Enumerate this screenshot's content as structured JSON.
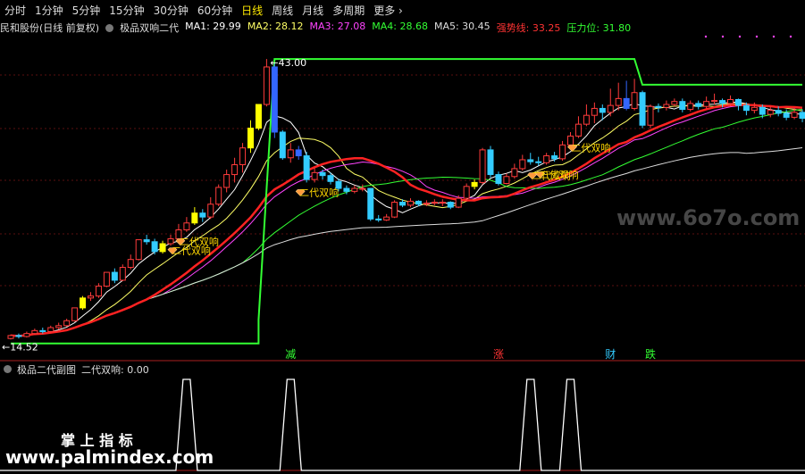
{
  "toolbar": {
    "items": [
      "分时",
      "1分钟",
      "5分钟",
      "15分钟",
      "30分钟",
      "60分钟",
      "日线",
      "周线",
      "月线",
      "多周期",
      "更多"
    ],
    "active_index": 6
  },
  "header": {
    "stock_name": "民和股份(日线 前复权)",
    "indicator_name": "极品双响二代",
    "ma_labels": [
      {
        "text": "MA1: 29.99",
        "color": "#ffffff"
      },
      {
        "text": "MA2: 28.12",
        "color": "#ffff66"
      },
      {
        "text": "MA3: 27.08",
        "color": "#ff44ff"
      },
      {
        "text": "MA4: 28.68",
        "color": "#33ff33"
      },
      {
        "text": "MA5: 30.45",
        "color": "#dddddd"
      },
      {
        "text": "强势线: 33.25",
        "color": "#ff3333"
      },
      {
        "text": "压力位: 31.80",
        "color": "#33ff33"
      }
    ]
  },
  "sub_panel": {
    "title": "极品二代副图",
    "value_label": "二代双响: 0.00"
  },
  "watermarks": {
    "top_right": "www.6o7o.com",
    "bottom_left_cn": "掌 上 指 标",
    "bottom_left_url": "www.palmindex.com"
  },
  "chart_data": {
    "type": "candlestick",
    "price_range": [
      13.0,
      45.0
    ],
    "high_label": "43.00",
    "low_label": "14.52",
    "candles": [
      [
        14.7,
        15.0,
        14.6,
        15.1
      ],
      [
        15.0,
        14.9,
        14.7,
        15.2
      ],
      [
        14.9,
        15.2,
        14.8,
        15.4
      ],
      [
        15.2,
        15.5,
        15.1,
        15.7
      ],
      [
        15.5,
        15.4,
        15.2,
        15.8
      ],
      [
        15.4,
        15.8,
        15.3,
        16.0
      ],
      [
        15.8,
        16.0,
        15.6,
        16.3
      ],
      [
        16.0,
        16.5,
        15.9,
        16.7
      ],
      [
        16.5,
        17.8,
        16.4,
        17.8
      ],
      [
        17.8,
        18.8,
        17.6,
        19.0
      ],
      [
        18.8,
        19.0,
        18.5,
        19.4
      ],
      [
        19.0,
        20.0,
        18.8,
        20.3
      ],
      [
        20.0,
        21.4,
        19.9,
        21.4
      ],
      [
        21.4,
        20.6,
        20.3,
        21.8
      ],
      [
        20.6,
        21.9,
        20.5,
        22.2
      ],
      [
        21.9,
        22.7,
        21.7,
        23.2
      ],
      [
        22.7,
        24.7,
        22.6,
        24.7
      ],
      [
        24.7,
        24.5,
        24.2,
        25.2
      ],
      [
        24.5,
        23.5,
        23.2,
        24.8
      ],
      [
        23.5,
        24.3,
        23.3,
        24.6
      ],
      [
        24.3,
        24.8,
        24.1,
        25.2
      ],
      [
        24.8,
        25.7,
        24.6,
        26.3
      ],
      [
        25.7,
        26.4,
        25.5,
        27.0
      ],
      [
        26.4,
        27.4,
        26.2,
        28.0
      ],
      [
        27.4,
        27.0,
        26.5,
        27.8
      ],
      [
        27.0,
        28.3,
        26.8,
        29.0
      ],
      [
        28.3,
        30.0,
        28.1,
        30.3
      ],
      [
        30.0,
        31.3,
        29.5,
        31.8
      ],
      [
        31.3,
        32.3,
        30.5,
        33.0
      ],
      [
        32.3,
        34.0,
        31.5,
        34.5
      ],
      [
        34.0,
        36.0,
        33.5,
        36.8
      ],
      [
        36.0,
        38.4,
        35.8,
        38.4
      ],
      [
        38.4,
        42.2,
        38.2,
        43.0
      ],
      [
        42.2,
        35.6,
        35.0,
        42.5
      ],
      [
        35.6,
        33.0,
        32.8,
        35.8
      ],
      [
        33.0,
        33.8,
        32.5,
        34.5
      ],
      [
        33.8,
        33.2,
        32.8,
        34.2
      ],
      [
        33.2,
        30.8,
        30.5,
        33.6
      ],
      [
        30.8,
        31.5,
        30.5,
        32.0
      ],
      [
        31.5,
        31.2,
        30.8,
        31.8
      ],
      [
        31.2,
        30.6,
        30.3,
        31.5
      ],
      [
        30.6,
        29.9,
        29.6,
        30.9
      ],
      [
        29.9,
        29.6,
        29.3,
        30.2
      ],
      [
        29.6,
        29.9,
        29.4,
        30.2
      ],
      [
        29.9,
        29.9,
        29.6,
        30.3
      ],
      [
        29.9,
        26.8,
        26.6,
        29.9
      ],
      [
        26.8,
        26.7,
        26.5,
        27.2
      ],
      [
        26.7,
        27.0,
        26.6,
        27.3
      ],
      [
        27.0,
        28.5,
        26.9,
        28.7
      ],
      [
        28.5,
        28.2,
        28.0,
        28.8
      ],
      [
        28.2,
        28.6,
        28.0,
        28.9
      ],
      [
        28.6,
        28.3,
        28.1,
        28.7
      ],
      [
        28.3,
        28.4,
        28.1,
        28.7
      ],
      [
        28.4,
        28.5,
        28.2,
        28.8
      ],
      [
        28.5,
        28.5,
        28.1,
        28.8
      ],
      [
        28.5,
        28.0,
        27.8,
        28.6
      ],
      [
        28.0,
        28.9,
        27.9,
        29.2
      ],
      [
        28.9,
        30.1,
        28.7,
        30.4
      ],
      [
        30.1,
        30.5,
        29.8,
        30.8
      ],
      [
        30.5,
        33.8,
        30.3,
        34.0
      ],
      [
        33.8,
        31.3,
        31.0,
        34.2
      ],
      [
        31.3,
        30.4,
        30.2,
        31.6
      ],
      [
        30.4,
        31.1,
        30.3,
        31.4
      ],
      [
        31.1,
        31.9,
        30.9,
        32.4
      ],
      [
        31.9,
        32.8,
        31.7,
        33.3
      ],
      [
        32.8,
        32.6,
        32.3,
        33.5
      ],
      [
        32.6,
        32.5,
        32.2,
        33.1
      ],
      [
        32.5,
        33.2,
        32.3,
        33.5
      ],
      [
        33.2,
        32.9,
        32.6,
        33.6
      ],
      [
        32.9,
        34.3,
        32.7,
        34.7
      ],
      [
        34.3,
        35.2,
        34.1,
        35.6
      ],
      [
        35.2,
        36.4,
        35.0,
        37.2
      ],
      [
        36.4,
        37.3,
        36.2,
        38.4
      ],
      [
        37.3,
        38.0,
        36.5,
        38.6
      ],
      [
        38.0,
        37.6,
        36.8,
        38.4
      ],
      [
        37.6,
        38.3,
        37.2,
        40.0
      ],
      [
        38.3,
        39.0,
        37.8,
        40.6
      ],
      [
        39.0,
        38.0,
        37.8,
        40.8
      ],
      [
        38.0,
        39.6,
        37.8,
        41.0
      ],
      [
        39.6,
        36.3,
        36.0,
        39.8
      ],
      [
        36.3,
        38.2,
        36.0,
        38.4
      ],
      [
        38.2,
        38.1,
        37.6,
        38.5
      ],
      [
        38.1,
        38.4,
        37.8,
        38.8
      ],
      [
        38.4,
        38.7,
        38.2,
        39.0
      ],
      [
        38.7,
        37.9,
        37.6,
        39.0
      ],
      [
        37.9,
        38.5,
        37.7,
        38.8
      ],
      [
        38.5,
        38.2,
        37.9,
        38.8
      ],
      [
        38.2,
        38.7,
        38.0,
        39.2
      ],
      [
        38.7,
        38.8,
        38.4,
        39.5
      ],
      [
        38.8,
        38.5,
        38.1,
        39.0
      ],
      [
        38.5,
        38.9,
        38.2,
        39.3
      ],
      [
        38.9,
        38.3,
        37.8,
        39.0
      ],
      [
        38.3,
        37.8,
        37.3,
        38.6
      ],
      [
        37.8,
        38.1,
        37.5,
        38.6
      ],
      [
        38.1,
        37.4,
        37.0,
        38.4
      ],
      [
        37.4,
        37.8,
        37.1,
        38.2
      ],
      [
        37.8,
        37.5,
        37.2,
        38.2
      ],
      [
        37.5,
        37.1,
        36.8,
        37.9
      ],
      [
        37.1,
        37.6,
        36.9,
        38.0
      ],
      [
        37.6,
        37.0,
        36.6,
        37.9
      ]
    ],
    "signals": [
      {
        "index": 22,
        "text": "二代双响"
      },
      {
        "index": 21,
        "text": "二代双响"
      },
      {
        "index": 37,
        "text": "二代双响"
      },
      {
        "index": 67,
        "text": "二代双响"
      },
      {
        "index": 66,
        "text": "二代双响"
      },
      {
        "index": 71,
        "text": "二代双响"
      }
    ],
    "events": [
      {
        "index": 35,
        "text": "减",
        "color": "#33ff33"
      },
      {
        "index": 61,
        "text": "涨",
        "color": "#ff3333"
      },
      {
        "index": 75,
        "text": "财",
        "color": "#33ccff"
      },
      {
        "index": 80,
        "text": "跌",
        "color": "#33ff33"
      }
    ],
    "pressure_line": [
      [
        0,
        14.2
      ],
      [
        31,
        14.2
      ],
      [
        31,
        16.6
      ],
      [
        33,
        43.0
      ],
      [
        78,
        43.0
      ],
      [
        79,
        40.4
      ],
      [
        99,
        40.4
      ]
    ],
    "sub_series": {
      "range": [
        0,
        1
      ],
      "peaks": [
        22,
        35,
        65,
        70
      ]
    },
    "ma_series": [
      {
        "name": "MA1",
        "color": "#ffffff",
        "period": 5
      },
      {
        "name": "MA2",
        "color": "#ffff66",
        "period": 10
      },
      {
        "name": "MA3",
        "color": "#ff44ff",
        "period": 20
      },
      {
        "name": "MA4",
        "color": "#33ff33",
        "period": 30
      },
      {
        "name": "MA5",
        "color": "#dddddd",
        "period": 60
      }
    ]
  }
}
